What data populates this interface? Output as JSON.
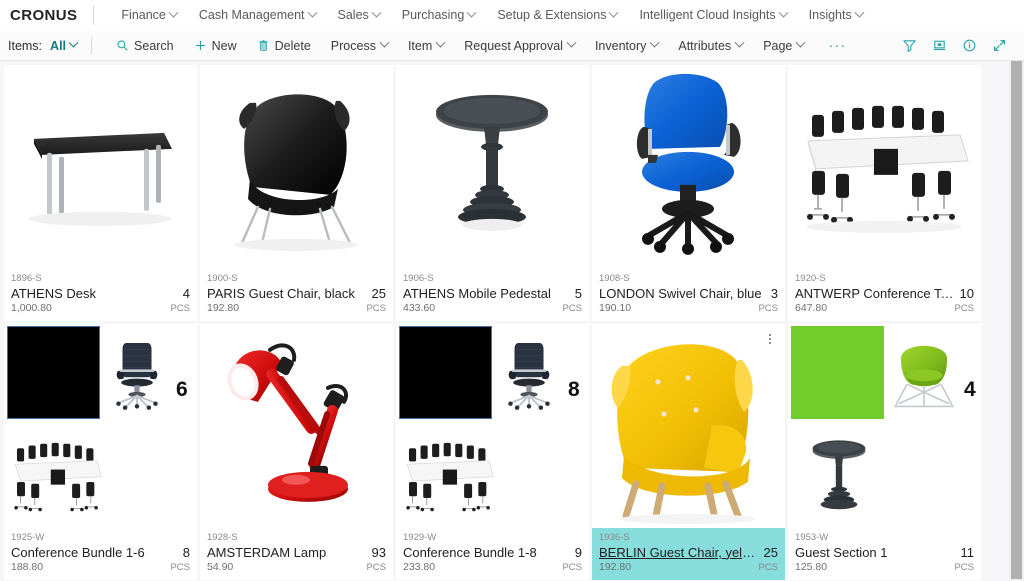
{
  "topnav": {
    "brand": "CRONUS",
    "items": [
      {
        "label": "Finance",
        "caret": true
      },
      {
        "label": "Cash Management",
        "caret": true
      },
      {
        "label": "Sales",
        "caret": true
      },
      {
        "label": "Purchasing",
        "caret": true
      },
      {
        "label": "Setup & Extensions",
        "caret": true
      },
      {
        "label": "Intelligent Cloud Insights",
        "caret": true
      },
      {
        "label": "Insights",
        "caret": true
      }
    ]
  },
  "commandbar": {
    "entity_label": "Items:",
    "filter_value": "All",
    "actions": [
      {
        "label": "Search",
        "icon": "search-icon",
        "caret": false
      },
      {
        "label": "New",
        "icon": "plus-icon",
        "caret": false
      },
      {
        "label": "Delete",
        "icon": "trash-icon",
        "caret": false
      },
      {
        "label": "Process",
        "icon": "",
        "caret": true
      },
      {
        "label": "Item",
        "icon": "",
        "caret": true
      },
      {
        "label": "Request Approval",
        "icon": "",
        "caret": true
      },
      {
        "label": "Inventory",
        "icon": "",
        "caret": true
      },
      {
        "label": "Attributes",
        "icon": "",
        "caret": true
      },
      {
        "label": "Page",
        "icon": "",
        "caret": true
      }
    ],
    "overflow_label": "···",
    "right_icons": [
      {
        "name": "filter-icon"
      },
      {
        "name": "share-icon"
      },
      {
        "name": "info-icon"
      },
      {
        "name": "expand-icon"
      }
    ],
    "accent_color": "#127a80"
  },
  "gallery": {
    "selection_color": "#87dcdc",
    "uom": "PCS",
    "cards": [
      {
        "code": "1896-S",
        "title": "ATHENS Desk",
        "qty": "4",
        "price": "1,000.80",
        "uom": "PCS",
        "image": "desk-black",
        "selected": false,
        "menu": false
      },
      {
        "code": "1900-S",
        "title": "PARIS Guest Chair, black",
        "qty": "25",
        "price": "192.80",
        "uom": "PCS",
        "image": "lounge-chair-black",
        "selected": false,
        "menu": false
      },
      {
        "code": "1906-S",
        "title": "ATHENS Mobile Pedestal",
        "qty": "5",
        "price": "433.60",
        "uom": "PCS",
        "image": "round-pedestal-table",
        "selected": false,
        "menu": false
      },
      {
        "code": "1908-S",
        "title": "LONDON Swivel Chair, blue",
        "qty": "3",
        "price": "190.10",
        "uom": "PCS",
        "image": "swivel-chair-blue",
        "selected": false,
        "menu": false
      },
      {
        "code": "1920-S",
        "title": "ANTWERP Conference Table",
        "qty": "10",
        "price": "647.80",
        "uom": "PCS",
        "image": "conference-table",
        "selected": false,
        "menu": false
      },
      {
        "code": "1925-W",
        "title": "Conference Bundle 1-6",
        "qty": "8",
        "price": "188.80",
        "uom": "PCS",
        "image": "bundle-6",
        "bundle_count": "6",
        "selected": false,
        "menu": false
      },
      {
        "code": "1928-S",
        "title": "AMSTERDAM Lamp",
        "qty": "93",
        "price": "54.90",
        "uom": "PCS",
        "image": "desk-lamp-red",
        "selected": false,
        "menu": false
      },
      {
        "code": "1929-W",
        "title": "Conference Bundle 1-8",
        "qty": "9",
        "price": "233.80",
        "uom": "PCS",
        "image": "bundle-8",
        "bundle_count": "8",
        "selected": false,
        "menu": false
      },
      {
        "code": "1936-S",
        "title": "BERLIN Guest Chair, yellow",
        "qty": "25",
        "price": "192.80",
        "uom": "PCS",
        "image": "armchair-yellow",
        "selected": true,
        "menu": true
      },
      {
        "code": "1953-W",
        "title": "Guest Section 1",
        "qty": "11",
        "price": "125.80",
        "uom": "PCS",
        "image": "bundle-green-4",
        "bundle_count": "4",
        "selected": false,
        "menu": false
      }
    ]
  }
}
